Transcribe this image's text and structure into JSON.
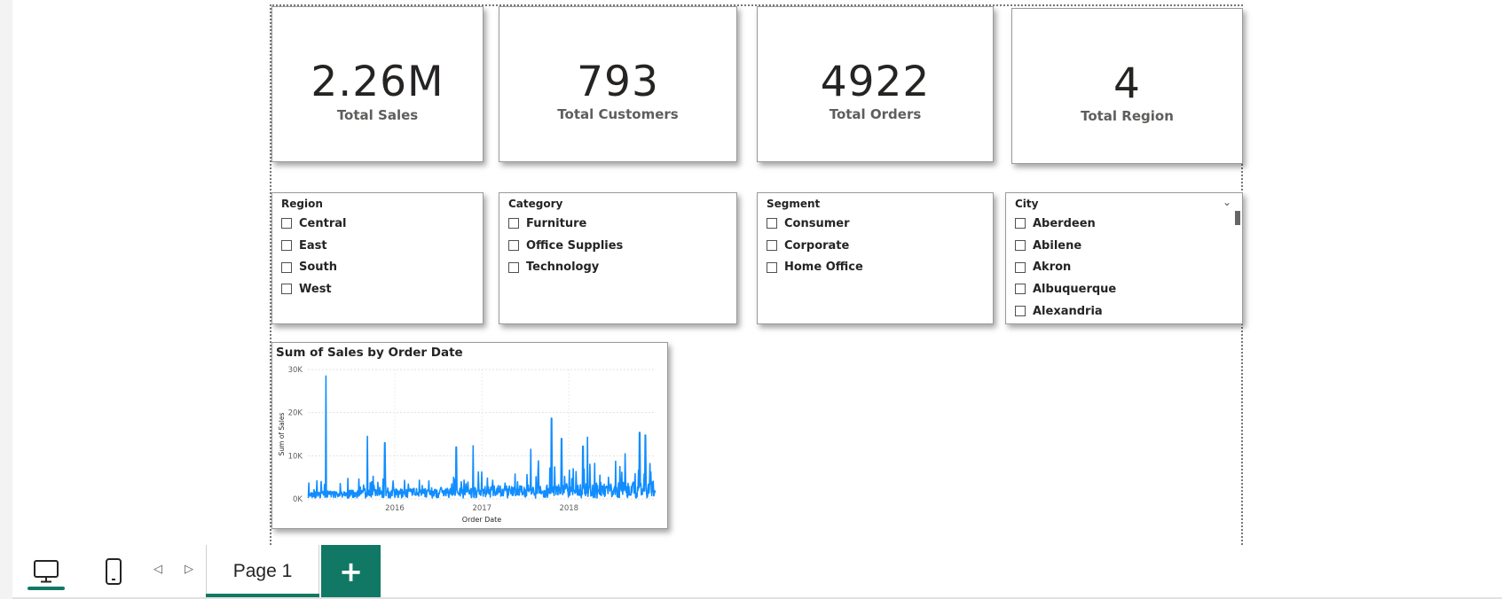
{
  "kpis": [
    {
      "value": "2.26M",
      "label": "Total Sales"
    },
    {
      "value": "793",
      "label": "Total Customers"
    },
    {
      "value": "4922",
      "label": "Total Orders"
    },
    {
      "value": "4",
      "label": "Total Region"
    }
  ],
  "slicers": {
    "region": {
      "title": "Region",
      "items": [
        "Central",
        "East",
        "South",
        "West"
      ]
    },
    "category": {
      "title": "Category",
      "items": [
        "Furniture",
        "Office Supplies",
        "Technology"
      ]
    },
    "segment": {
      "title": "Segment",
      "items": [
        "Consumer",
        "Corporate",
        "Home Office"
      ]
    },
    "city": {
      "title": "City",
      "items": [
        "Aberdeen",
        "Abilene",
        "Akron",
        "Albuquerque",
        "Alexandria"
      ]
    }
  },
  "icons": {
    "dropdown": "chevron-down-icon",
    "desktop_view": "monitor-icon",
    "mobile_view": "phone-icon",
    "prev": "triangle-left-icon",
    "next": "triangle-right-icon",
    "add": "plus-icon"
  },
  "colors": {
    "series": "#118DFF",
    "accent": "#117865"
  },
  "chart_data": {
    "type": "line",
    "title": "Sum of Sales by Order Date",
    "xlabel": "Order Date",
    "ylabel": "Sum of Sales",
    "x_ticks": [
      "2016",
      "2017",
      "2018"
    ],
    "y_ticks": [
      "0K",
      "10K",
      "20K",
      "30K"
    ],
    "ylim": [
      0,
      30000
    ],
    "xlim": [
      "2015-01-01",
      "2018-12-31"
    ],
    "grid": true,
    "peaks": [
      {
        "date": "2015-03-18",
        "value": 28500
      },
      {
        "date": "2015-09-08",
        "value": 14500
      },
      {
        "date": "2015-11-20",
        "value": 13000
      },
      {
        "date": "2016-09-15",
        "value": 12000
      },
      {
        "date": "2016-11-25",
        "value": 12300
      },
      {
        "date": "2017-07-25",
        "value": 11500
      },
      {
        "date": "2017-10-20",
        "value": 18700
      },
      {
        "date": "2017-12-01",
        "value": 14000
      },
      {
        "date": "2018-03-01",
        "value": 12200
      },
      {
        "date": "2018-03-20",
        "value": 14300
      },
      {
        "date": "2018-10-25",
        "value": 15400
      },
      {
        "date": "2018-11-18",
        "value": 14800
      }
    ]
  },
  "footer": {
    "page_tab": "Page 1",
    "add_label": "+"
  }
}
